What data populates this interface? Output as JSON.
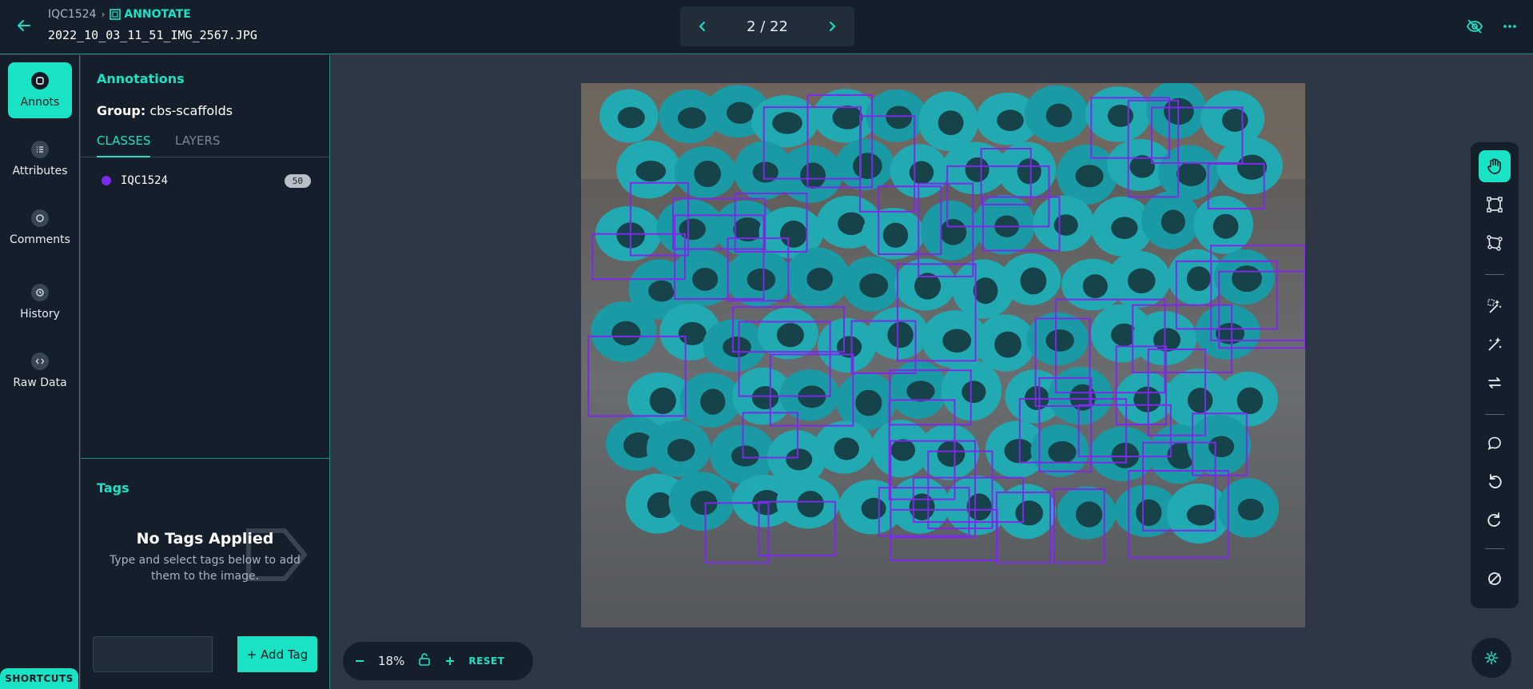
{
  "header": {
    "project": "IQC1524",
    "mode": "ANNOTATE",
    "filename": "2022_10_03_11_51_IMG_2567.JPG",
    "pager": "2 / 22"
  },
  "rail": {
    "items": [
      {
        "label": "Annots",
        "icon": "annotation-icon",
        "active": true
      },
      {
        "label": "Attributes",
        "icon": "list-icon"
      },
      {
        "label": "Comments",
        "icon": "comment-icon"
      },
      {
        "label": "History",
        "icon": "history-icon"
      },
      {
        "label": "Raw Data",
        "icon": "code-icon"
      }
    ],
    "shortcuts": "SHORTCUTS"
  },
  "panel": {
    "title": "Annotations",
    "group_label": "Group:",
    "group_value": "cbs-scaffolds",
    "tabs": [
      "CLASSES",
      "LAYERS"
    ],
    "classes": [
      {
        "name": "IQC1524",
        "count": "50",
        "color": "#7d2ae8"
      }
    ],
    "tags_title": "Tags",
    "no_tags_title": "No Tags Applied",
    "no_tags_desc": "Type and select tags below to add them to the image.",
    "add_tag": "+ Add Tag"
  },
  "zoom": {
    "value": "18%",
    "reset": "RESET"
  },
  "colors": {
    "accent": "#19e3c4",
    "box": "#7d2ae8",
    "panel_bg": "#151f2b",
    "canvas_bg": "#2d3745"
  }
}
